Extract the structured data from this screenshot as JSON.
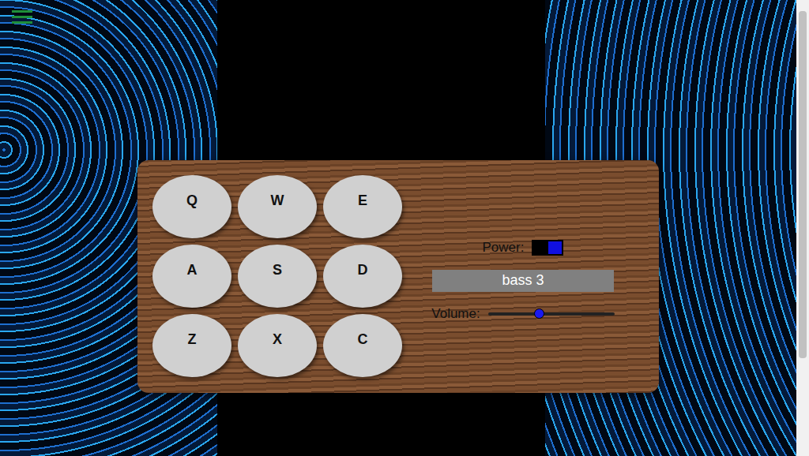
{
  "pads": [
    {
      "key": "Q"
    },
    {
      "key": "W"
    },
    {
      "key": "E"
    },
    {
      "key": "A"
    },
    {
      "key": "S"
    },
    {
      "key": "D"
    },
    {
      "key": "Z"
    },
    {
      "key": "X"
    },
    {
      "key": "C"
    }
  ],
  "power": {
    "label": "Power:",
    "on": true
  },
  "display": "bass 3",
  "volume": {
    "label": "Volume:",
    "level": 0.4
  }
}
